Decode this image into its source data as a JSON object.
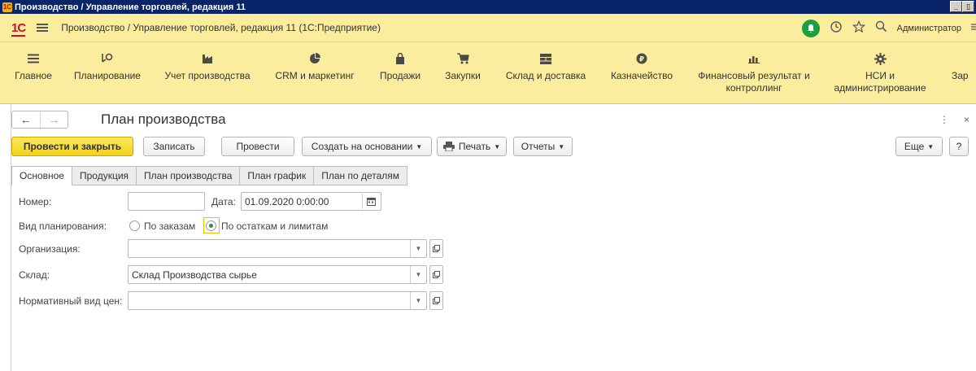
{
  "window": {
    "title": "Производство / Управление торговлей, редакция 11",
    "icon_text": "1С",
    "buttons": [
      "_",
      "▯"
    ]
  },
  "header": {
    "logo": "1С",
    "app_title": "Производство / Управление торговлей, редакция 11  (1С:Предприятие)",
    "user": "Администратор",
    "icons": [
      "bell-icon",
      "history-icon",
      "star-icon",
      "search-icon"
    ],
    "accent_color": "#fbed9e",
    "bell_color": "#1d9f3e"
  },
  "sections": [
    {
      "label": "Главное",
      "icon": "hamburger-icon"
    },
    {
      "label": "Планирование",
      "icon": "planning-icon"
    },
    {
      "label": "Учет производства",
      "icon": "factory-icon"
    },
    {
      "label": "CRM и маркетинг",
      "icon": "pie-icon"
    },
    {
      "label": "Продажи",
      "icon": "bag-icon"
    },
    {
      "label": "Закупки",
      "icon": "cart-icon"
    },
    {
      "label": "Склад и доставка",
      "icon": "warehouse-icon"
    },
    {
      "label": "Казначейство",
      "icon": "coin-icon"
    },
    {
      "label": "Финансовый результат и контроллинг",
      "icon": "chart-icon"
    },
    {
      "label": "НСИ и администрирование",
      "icon": "gear-icon"
    },
    {
      "label": "Зар",
      "icon": ""
    }
  ],
  "form": {
    "title": "План производства",
    "nav_back": "←",
    "nav_forward": "→",
    "more_icon": "⋮",
    "close_icon": "×",
    "toolbar": {
      "post_close": "Провести и закрыть",
      "save": "Записать",
      "post": "Провести",
      "create_based": "Создать на основании",
      "print": "Печать",
      "reports": "Отчеты",
      "more": "Еще",
      "help": "?"
    },
    "tabs": [
      "Основное",
      "Продукция",
      "План производства",
      "План график",
      "План по деталям"
    ],
    "fields": {
      "number_label": "Номер:",
      "number_value": "",
      "date_label": "Дата:",
      "date_value": "01.09.2020  0:00:00",
      "planning_type_label": "Вид планирования:",
      "planning_option_1": "По заказам",
      "planning_option_2": "По остаткам и лимитам",
      "organization_label": "Организация:",
      "organization_value": "",
      "warehouse_label": "Склад:",
      "warehouse_value": "Склад Производства сырье",
      "price_type_label": "Нормативный вид цен:",
      "price_type_value": ""
    }
  }
}
